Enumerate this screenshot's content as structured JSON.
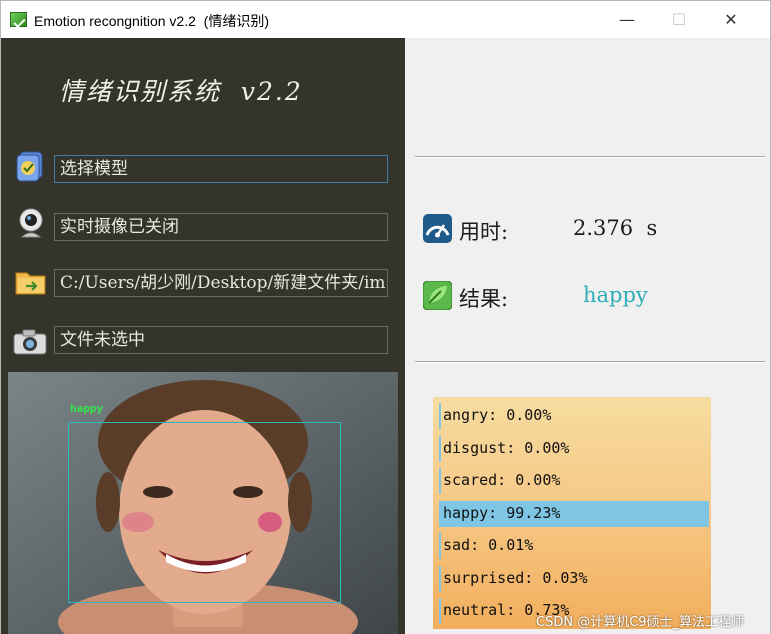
{
  "window": {
    "title": "Emotion recongnition v2.2  (情绪识别)",
    "controls": {
      "minimize": "—",
      "maximize": "☐",
      "close": "✕"
    }
  },
  "app": {
    "heading": "情绪识别系统  v2.2"
  },
  "controls": {
    "model": {
      "icon": "model-select-icon",
      "value": "选择模型"
    },
    "camera": {
      "icon": "webcam-icon",
      "value": "实时摄像已关闭"
    },
    "folder": {
      "icon": "folder-open-icon",
      "value": "C:/Users/胡少刚/Desktop/新建文件夹/im"
    },
    "file": {
      "icon": "camera-icon",
      "value": "文件未选中"
    }
  },
  "preview": {
    "face_label": "happy",
    "box_color": "#2fb7c4",
    "label_color": "#33e64a"
  },
  "stats": {
    "time": {
      "icon": "speedometer-icon",
      "label": "用时:",
      "value": "2.376  s"
    },
    "result": {
      "icon": "leaf-check-icon",
      "label": "结果:",
      "value": "happy"
    }
  },
  "probabilities": [
    {
      "label": "angry: 0.00%",
      "value": 0.0
    },
    {
      "label": "disgust: 0.00%",
      "value": 0.0
    },
    {
      "label": "scared: 0.00%",
      "value": 0.0
    },
    {
      "label": "happy: 99.23%",
      "value": 0.9923
    },
    {
      "label": "sad: 0.01%",
      "value": 0.0001
    },
    {
      "label": "surprised: 0.03%",
      "value": 0.0003
    },
    {
      "label": "neutral: 0.73%",
      "value": 0.0073
    }
  ],
  "watermark": "CSDN @计算机C9硕士_算法工程师",
  "colors": {
    "left_panel": "#34342b",
    "accent_result": "#2dadb5",
    "bar_fill": "#7fc6e5"
  }
}
